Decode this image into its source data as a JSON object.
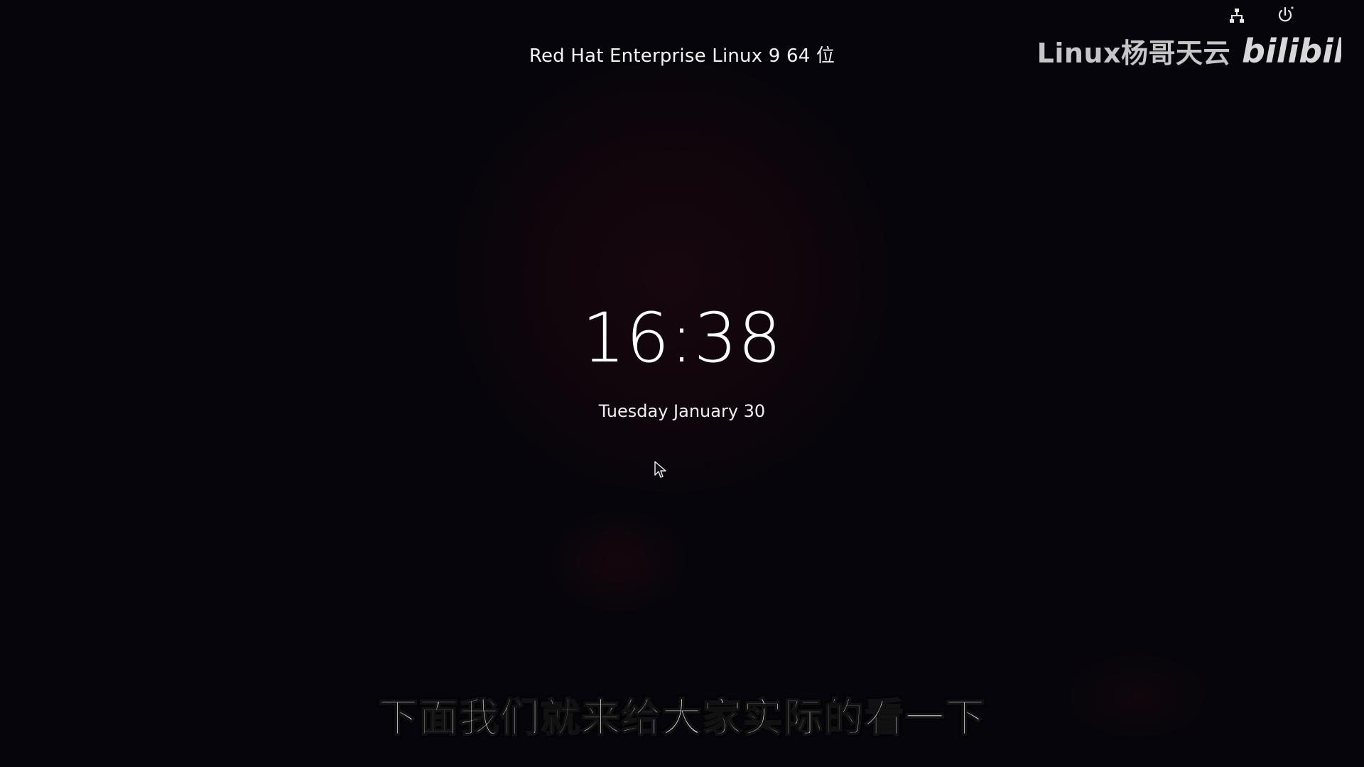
{
  "os_title": "Red Hat Enterprise Linux 9 64 位",
  "lock_screen": {
    "time": "16:38",
    "date": "Tuesday January 30"
  },
  "status_icons": {
    "network": "network-icon",
    "power": "power-icon"
  },
  "watermark": {
    "channel": "Linux杨哥天云",
    "logo": "bilibili"
  },
  "subtitle": "下面我们就来给大家实际的看一下",
  "colors": {
    "background": "#05050b",
    "text": "#ffffff",
    "accent_glow": "#461014"
  }
}
